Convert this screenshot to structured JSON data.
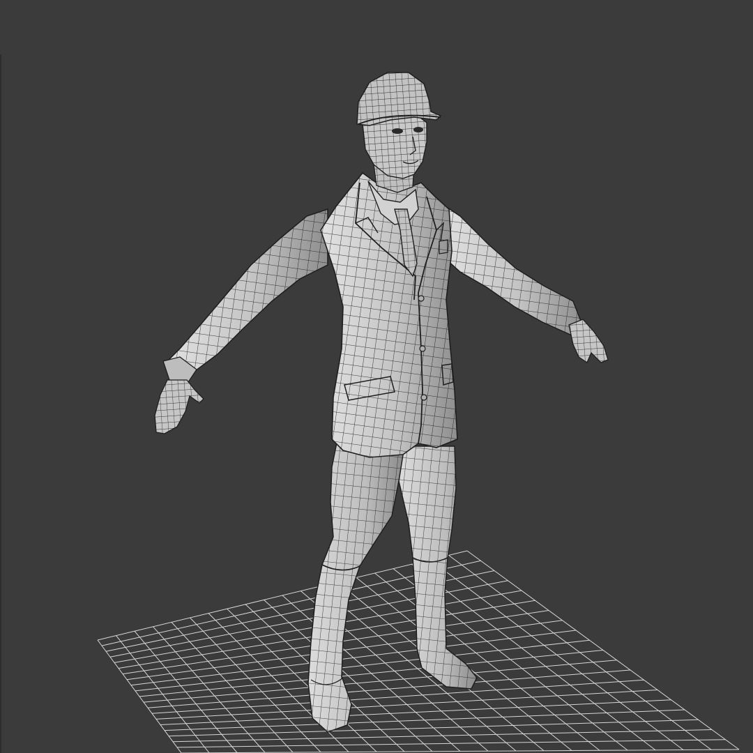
{
  "viewport": {
    "background": "#3b3b3b",
    "grid_color": "#d8d8d8",
    "mesh_fill": "#c9c9c9",
    "mesh_shadow": "#8f8f8f",
    "wire_color": "#1e1e1e",
    "view_mode": "shaded-with-wireframe"
  },
  "scene": {
    "object": "character-mesh",
    "pose": "A-pose"
  }
}
